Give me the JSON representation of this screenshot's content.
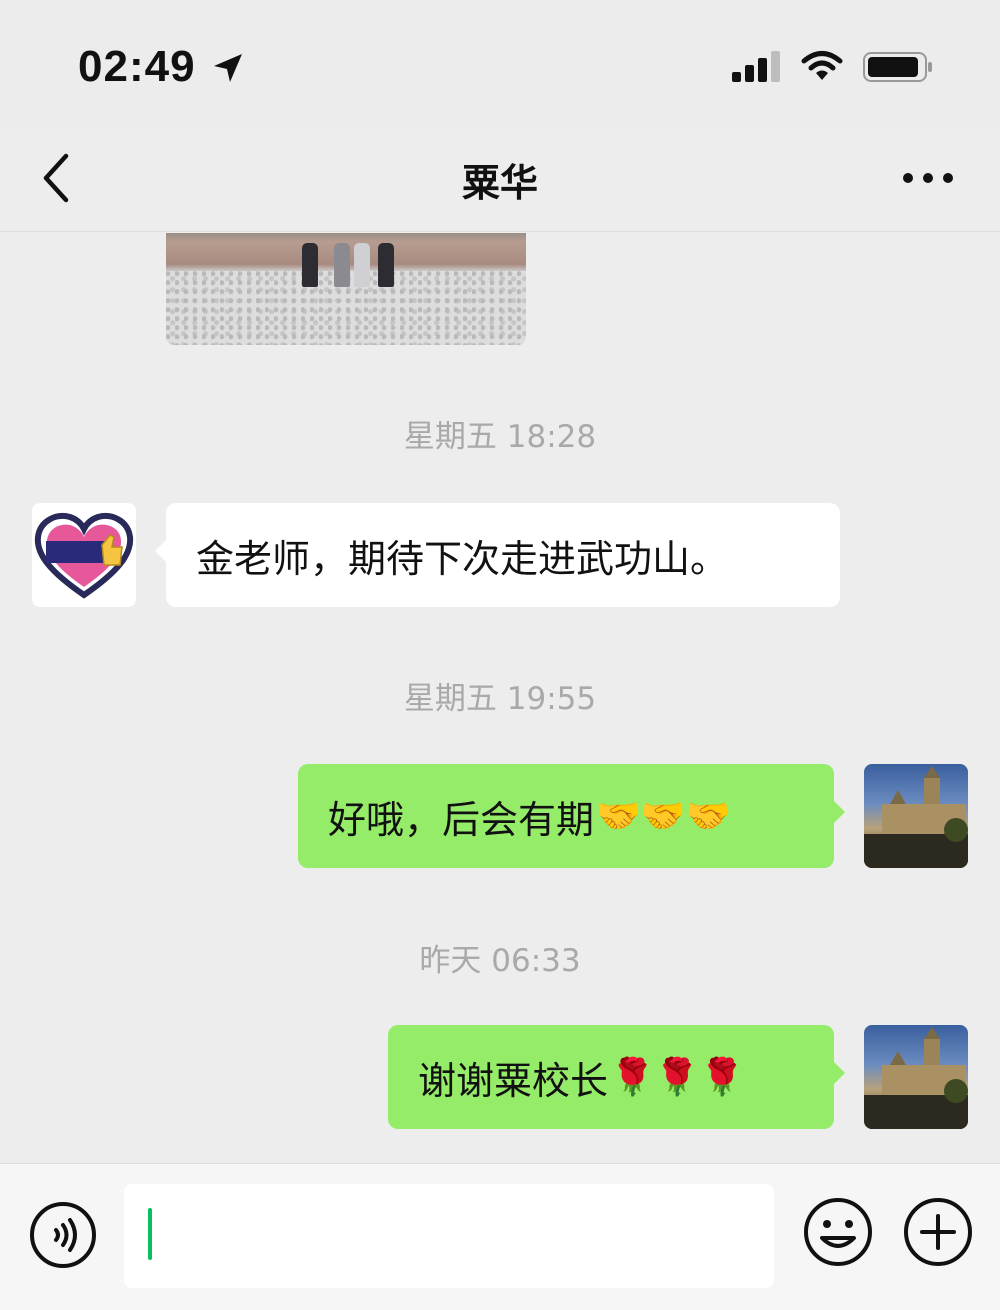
{
  "status_bar": {
    "time": "02:49",
    "icons": [
      "location-arrow-icon",
      "cellular-signal-icon",
      "wifi-icon",
      "battery-icon"
    ]
  },
  "nav": {
    "back_icon": "chevron-left-icon",
    "title": "粟华",
    "more_icon": "more-dots-icon"
  },
  "messages": [
    {
      "kind": "image",
      "side": "left",
      "description_icon": "photo-thumbnail"
    },
    {
      "kind": "timestamp",
      "text": "星期五 18:28"
    },
    {
      "kind": "text",
      "side": "left",
      "text": "金老师，期待下次走进武功山。",
      "emoji": ""
    },
    {
      "kind": "timestamp",
      "text": "星期五 19:55"
    },
    {
      "kind": "text",
      "side": "right",
      "text": "好哦，后会有期",
      "emoji": "🤝🤝🤝"
    },
    {
      "kind": "timestamp",
      "text": "昨天 06:33"
    },
    {
      "kind": "text",
      "side": "right",
      "text": "谢谢粟校长",
      "emoji": "🌹🌹🌹"
    }
  ],
  "input_bar": {
    "voice_icon": "voice-input-icon",
    "text_value": "",
    "emoji_icon": "emoji-smiley-icon",
    "plus_icon": "plus-circle-icon"
  },
  "colors": {
    "background": "#ededed",
    "bubble_self": "#95ec69",
    "bubble_other": "#ffffff",
    "timestamp_text": "#a9a9a9",
    "caret": "#07c160"
  }
}
